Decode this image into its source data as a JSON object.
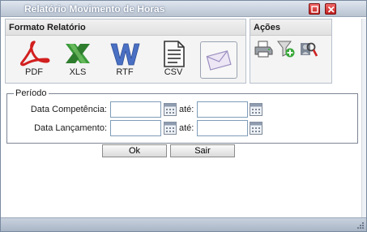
{
  "window": {
    "title": "Relatório Movimento de Horas"
  },
  "formato": {
    "heading": "Formato Relatório",
    "items": [
      {
        "id": "pdf",
        "label": "PDF",
        "icon": "pdf-icon"
      },
      {
        "id": "xls",
        "label": "XLS",
        "icon": "xls-icon"
      },
      {
        "id": "rtf",
        "label": "RTF",
        "icon": "rtf-icon"
      },
      {
        "id": "csv",
        "label": "CSV",
        "icon": "csv-icon"
      },
      {
        "id": "email",
        "label": "",
        "icon": "envelope-icon"
      }
    ]
  },
  "acoes": {
    "heading": "Ações",
    "icons": [
      "printer-icon",
      "filter-add-icon",
      "search-user-icon"
    ]
  },
  "periodo": {
    "legend": "Período",
    "rows": [
      {
        "label": "Data Competência:",
        "from": "",
        "ate": "até:",
        "to": ""
      },
      {
        "label": "Data Lançamento:",
        "from": "",
        "ate": "até:",
        "to": ""
      }
    ]
  },
  "buttons": {
    "ok": "Ok",
    "sair": "Sair"
  },
  "colors": {
    "pdf": "#d21f1f",
    "xls": "#2e8b2e",
    "rtf": "#3c5fb3",
    "title_bg": "#c9d2de",
    "close": "#c11f1f"
  }
}
